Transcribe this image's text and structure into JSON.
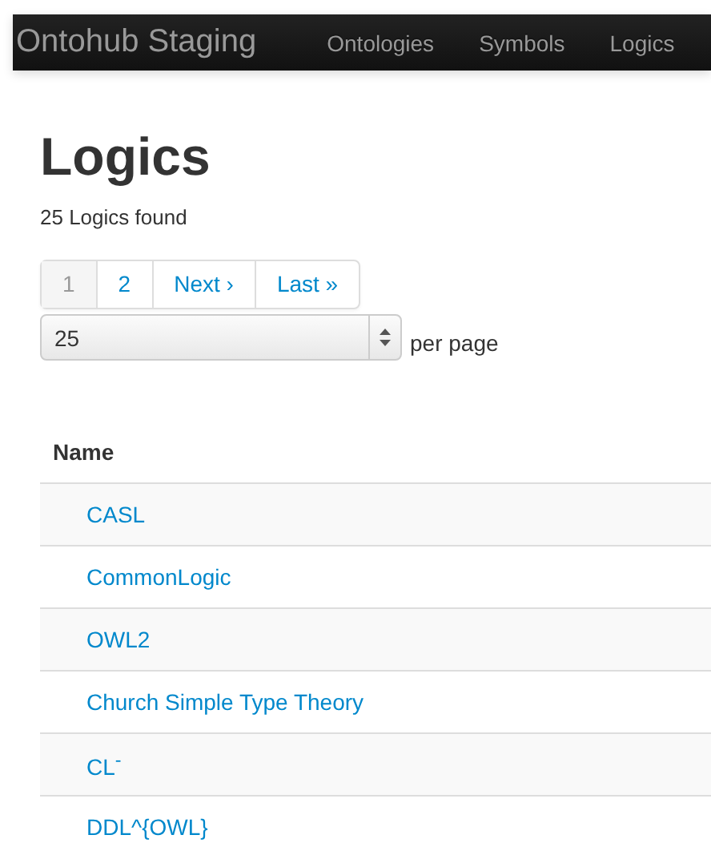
{
  "navbar": {
    "brand": "Ontohub Staging",
    "items": [
      {
        "label": "Ontologies"
      },
      {
        "label": "Symbols"
      },
      {
        "label": "Logics"
      }
    ]
  },
  "heading": "Logics",
  "count": "25 Logics found",
  "pagination": [
    {
      "label": "1",
      "selected": true
    },
    {
      "label": "2",
      "selected": false
    },
    {
      "label": "Next ›",
      "selected": false
    },
    {
      "label": "Last »",
      "selected": false
    }
  ],
  "per_page": {
    "value": "25",
    "label": "per page"
  },
  "table": {
    "columns": [
      "Name"
    ],
    "rows": [
      {
        "name": "CASL"
      },
      {
        "name": "CommonLogic"
      },
      {
        "name": "OWL2"
      },
      {
        "name": "Church Simple Type Theory"
      },
      {
        "name": "CL$^{-}$"
      },
      {
        "name": "DDL^{OWL}"
      }
    ]
  }
}
